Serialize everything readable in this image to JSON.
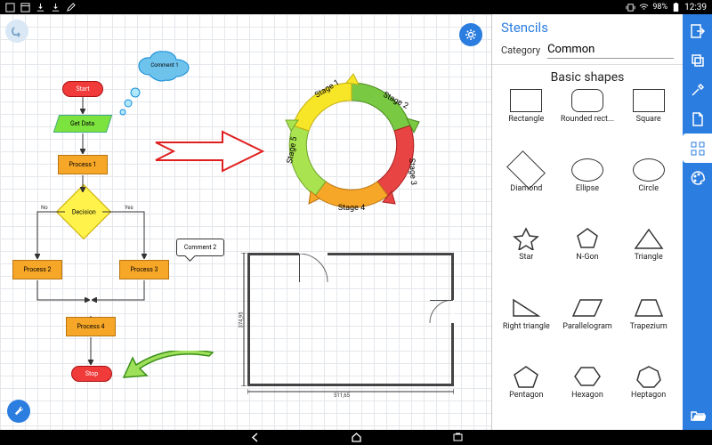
{
  "statusbar": {
    "battery": "98%",
    "time": "12:39"
  },
  "canvas": {
    "flowchart": {
      "start": "Start",
      "getdata": "Get Data",
      "process1": "Process 1",
      "decision": "Decision",
      "process2": "Process 2",
      "process3": "Process 3",
      "process4": "Process 4",
      "stop": "Stop",
      "dec_no": "No",
      "dec_yes": "Yes"
    },
    "comments": {
      "c1": "Comment 1",
      "c2": "Comment 2"
    },
    "cycle": {
      "s1": "Stage 1",
      "s2": "Stage 2",
      "s3": "Stage 3",
      "s4": "Stage 4",
      "s5": "Stage 5"
    },
    "floorplan": {
      "w": "511,65",
      "h": "374,95"
    }
  },
  "panel": {
    "title": "Stencils",
    "category_label": "Category",
    "category_value": "Common",
    "section": "Basic shapes",
    "shapes": [
      "Rectangle",
      "Rounded rect...",
      "Square",
      "Diamond",
      "Ellipse",
      "Circle",
      "Star",
      "N-Gon",
      "Triangle",
      "Right triangle",
      "Parallelogram",
      "Trapezium",
      "Pentagon",
      "Hexagon",
      "Heptagon"
    ]
  }
}
